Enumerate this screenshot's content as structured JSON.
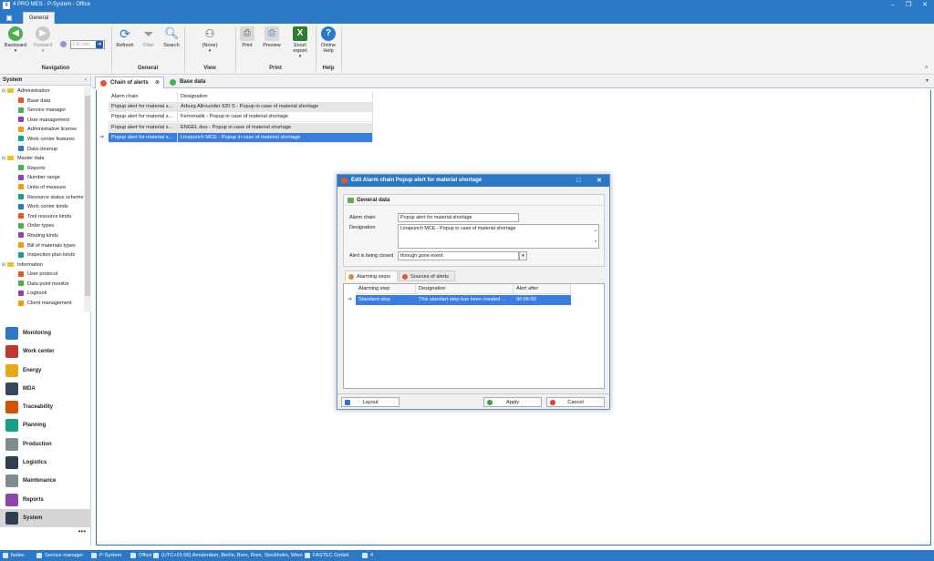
{
  "window": {
    "title": "4 PRO MES - P-System - Office"
  },
  "ribbon": {
    "tab": "General",
    "buttons": {
      "backward": "Backward",
      "forward": "Forward",
      "ccode_placeholder": "CitCode",
      "refresh": "Refresh",
      "filter": "Filter",
      "search": "Search",
      "view_none": "(None)",
      "print": "Print",
      "preview": "Preview",
      "excel": "Excel export",
      "help": "Online Help"
    },
    "groups": {
      "navigation": "Navigation",
      "general": "General",
      "view": "View",
      "print": "Print",
      "help": "Help"
    }
  },
  "sidebar": {
    "title": "System",
    "tree": [
      {
        "label": "Administration",
        "group": true
      },
      {
        "label": "Base data"
      },
      {
        "label": "Service manager"
      },
      {
        "label": "User management"
      },
      {
        "label": "Administrative license"
      },
      {
        "label": "Work center features"
      },
      {
        "label": "Data cleanup"
      },
      {
        "label": "Master data",
        "group": true
      },
      {
        "label": "Reports"
      },
      {
        "label": "Number range"
      },
      {
        "label": "Units of measure"
      },
      {
        "label": "Resource status scheme"
      },
      {
        "label": "Work center kinds"
      },
      {
        "label": "Tool resource kinds"
      },
      {
        "label": "Order types"
      },
      {
        "label": "Routing kinds"
      },
      {
        "label": "Bill of materials types"
      },
      {
        "label": "Inspection plan kinds"
      },
      {
        "label": "Information",
        "group": true
      },
      {
        "label": "User protocol"
      },
      {
        "label": "Data point monitor"
      },
      {
        "label": "Logbook"
      },
      {
        "label": "Client management"
      }
    ],
    "nav": [
      "Monitoring",
      "Work center",
      "Energy",
      "MDA",
      "Traceability",
      "Planning",
      "Production",
      "Logistics",
      "Maintenance",
      "Reports",
      "System"
    ],
    "more": "•••"
  },
  "main": {
    "tabs": [
      "Chain of alerts",
      "Base data"
    ],
    "columns": [
      "Alarm chain",
      "Designation"
    ],
    "rows": [
      [
        "Popup alert for material s...",
        "Arburg Allrounder 920 S - Popup in case of material shortage"
      ],
      [
        "Popup alert for material s...",
        "Ferromatik - Popup in case of material shortage"
      ],
      [
        "Popup alert for material s...",
        "ENGEL duo - Popup in case of material shortage"
      ],
      [
        "Popup alert for material s...",
        "Linapunch MCE - Popup in case of material shortage"
      ]
    ]
  },
  "dialog": {
    "title": "Edit Alarm chain Popup alert for material shortage",
    "section": "General data",
    "labels": {
      "alarm_chain": "Alarm chain",
      "designation": "Designation",
      "closed": "Alert is being closed"
    },
    "values": {
      "alarm_chain": "Popup alert for material shortage",
      "designation": "Linapunch MCE - Popup in case of material shortage",
      "closed": "through gone event"
    },
    "subtabs": [
      "Alarming steps",
      "Sources of alerts"
    ],
    "step_columns": [
      "Alarming step",
      "Designation",
      "Alert after"
    ],
    "step_row": [
      "Standard step",
      "This standart step has been created ...",
      "00:06:00"
    ],
    "buttons": {
      "layout": "Layout",
      "apply": "Apply",
      "cancel": "Cancel"
    }
  },
  "statusbar": [
    "fastec",
    "Service manager",
    "P-System",
    "Office",
    "(UTC+01:00) Amsterdam, Berlin, Bern, Rom, Stockholm, Wien",
    "FASTEC GmbH",
    "4"
  ]
}
